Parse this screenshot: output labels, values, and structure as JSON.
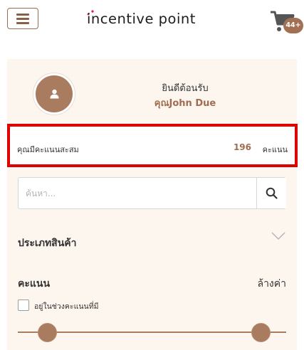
{
  "header": {
    "logo_text": "incentive point",
    "cart_badge": "44+"
  },
  "profile": {
    "welcome": "ยินดีต้อนรับ",
    "username": "คุณJohn Due"
  },
  "points": {
    "label": "คุณมีคะแนนสะสม",
    "value": "196",
    "unit": "คะแนน"
  },
  "search": {
    "placeholder": "ค้นหา..."
  },
  "filters": {
    "category_label": "ประเภทสินค้า",
    "score_label": "คะแนน",
    "reset_label": "ล้างค่า",
    "checkbox_label": "อยู่ในช่วงคะแนนที่มี"
  },
  "colors": {
    "accent": "#a97b5f",
    "highlight_border": "#e10000",
    "panel_bg": "#fdf6ef"
  }
}
